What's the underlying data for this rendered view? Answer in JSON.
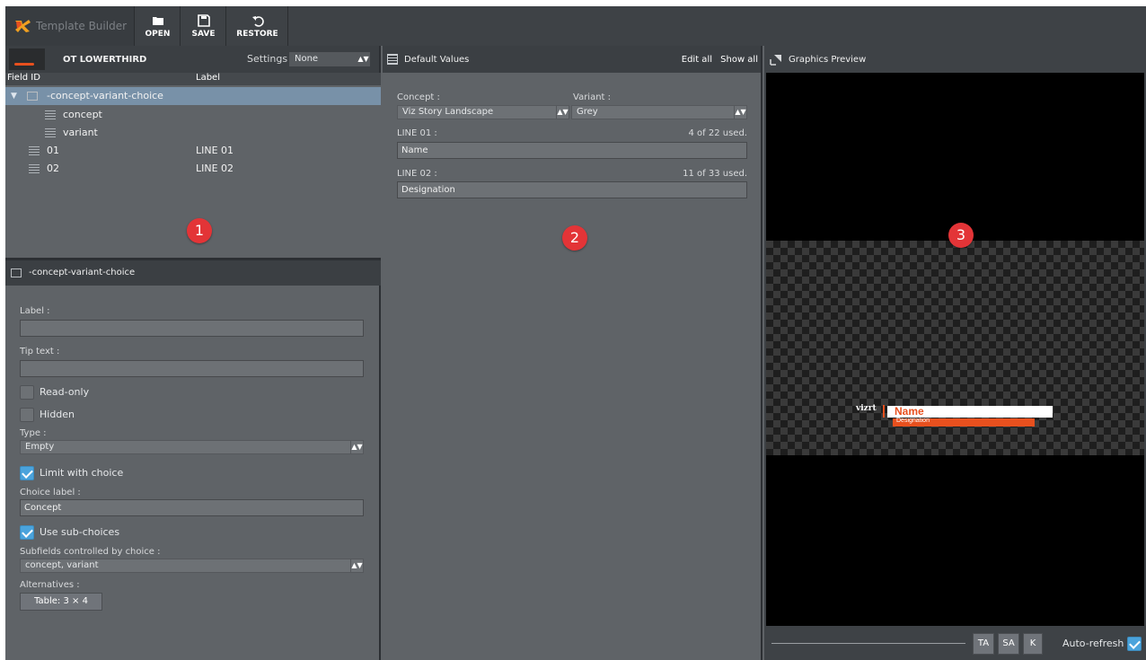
{
  "app": {
    "title": "Template Builder"
  },
  "toolbar": {
    "open": "OPEN",
    "save": "SAVE",
    "restore": "RESTORE"
  },
  "p1": {
    "template_name": "OT LOWERTHIRD",
    "settings_label": "Settings :",
    "settings_value": "None",
    "col_field_id": "Field ID",
    "col_label": "Label",
    "tree": [
      {
        "id": "-concept-variant-choice",
        "label": ""
      },
      {
        "id": "concept",
        "label": ""
      },
      {
        "id": "variant",
        "label": ""
      },
      {
        "id": "01",
        "label": "LINE 01"
      },
      {
        "id": "02",
        "label": "LINE 02"
      }
    ],
    "badge": "1"
  },
  "props": {
    "header": "-concept-variant-choice",
    "label_label": "Label :",
    "label_value": "",
    "tip_label": "Tip text :",
    "tip_value": "",
    "readonly": "Read-only",
    "hidden": "Hidden",
    "type_label": "Type :",
    "type_value": "Empty",
    "limit": "Limit with choice",
    "choice_label_label": "Choice label :",
    "choice_label_value": "Concept",
    "sub": "Use sub-choices",
    "subfields_label": "Subfields controlled by choice :",
    "subfields_value": "concept, variant",
    "alternatives_label": "Alternatives :",
    "alternatives_button": "Table: 3 × 4"
  },
  "p2": {
    "title": "Default Values",
    "edit_all": "Edit all",
    "show_all": "Show all",
    "concept_label": "Concept :",
    "concept_value": "Viz Story Landscape",
    "variant_label": "Variant :",
    "variant_value": "Grey",
    "line1_label": "LINE 01 :",
    "line1_count": "4 of 22 used.",
    "line1_value": "Name",
    "line2_label": "LINE 02 :",
    "line2_count": "11 of 33 used.",
    "line2_value": "Designation",
    "badge": "2"
  },
  "p3": {
    "title": "Graphics Preview",
    "badge": "3",
    "gfx_logo": "vizrt",
    "gfx_name": "Name",
    "gfx_designation": "Designation",
    "btn_ta": "TA",
    "btn_sa": "SA",
    "btn_k": "K",
    "auto_refresh": "Auto-refresh :"
  },
  "colors": {
    "accent": "#e8501e",
    "checkbox": "#4aa3dc",
    "badge": "#e33437",
    "selection": "#7891a8"
  }
}
